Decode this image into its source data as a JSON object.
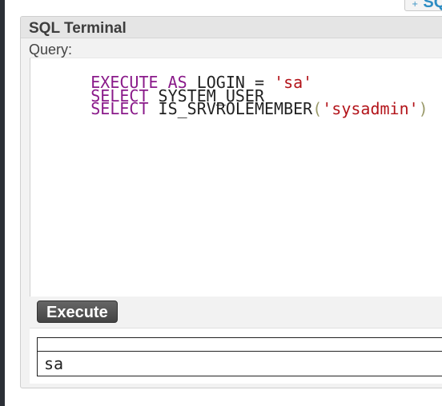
{
  "top_tab": {
    "icon": "plus-icon",
    "label": "SQ"
  },
  "panel": {
    "title": "SQL Terminal",
    "query_label": "Query:"
  },
  "editor": {
    "lines": [
      [
        {
          "text": "EXECUTE",
          "kind": "keyword"
        },
        {
          "text": " ",
          "kind": "plain"
        },
        {
          "text": "AS",
          "kind": "keyword"
        },
        {
          "text": " LOGIN = ",
          "kind": "plain"
        },
        {
          "text": "'sa'",
          "kind": "string"
        }
      ],
      [
        {
          "text": "SELECT",
          "kind": "keyword"
        },
        {
          "text": " SYSTEM_USER",
          "kind": "plain"
        }
      ],
      [
        {
          "text": "SELECT",
          "kind": "keyword"
        },
        {
          "text": " IS_SRVROLEMEMBER",
          "kind": "plain"
        },
        {
          "text": "(",
          "kind": "paren"
        },
        {
          "text": "'sysadmin'",
          "kind": "string"
        },
        {
          "text": ")",
          "kind": "paren"
        }
      ]
    ]
  },
  "execute_button": {
    "label": "Execute"
  },
  "results": {
    "header": "",
    "rows": [
      "sa"
    ]
  },
  "colors": {
    "keyword": "#8a1a8a",
    "string": "#b3141a",
    "paren": "#9a9a6a",
    "accent": "#2e8dc3"
  }
}
